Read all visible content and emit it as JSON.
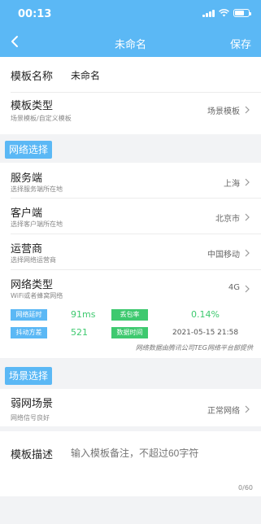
{
  "status_bar": {
    "time": "00:13"
  },
  "nav": {
    "back_icon": "chevron-left-icon",
    "title": "未命名",
    "save_label": "保存"
  },
  "template_name": {
    "label": "模板名称",
    "value": "未命名"
  },
  "template_type": {
    "title": "模板类型",
    "subtitle": "场景模板/自定义模板",
    "value": "场景模板"
  },
  "network_section": {
    "label": "网络选择"
  },
  "network_rows": [
    {
      "title": "服务端",
      "subtitle": "选择服务端所在地",
      "value": "上海"
    },
    {
      "title": "客户端",
      "subtitle": "选择客户端所在地",
      "value": "北京市"
    },
    {
      "title": "运营商",
      "subtitle": "选择网络运营商",
      "value": "中国移动"
    },
    {
      "title": "网络类型",
      "subtitle": "WiFi或者蜂窝网络",
      "value": "4G"
    }
  ],
  "metrics": {
    "latency_label": "网络延时",
    "latency_value": "91ms",
    "loss_label": "丢包率",
    "loss_value": "0.14%",
    "jitter_label": "抖动方差",
    "jitter_value": "521",
    "time_label": "数据时间",
    "time_value": "2021-05-15 21:58",
    "note": "网络数据由腾讯公司TEG网络平台部提供"
  },
  "scene_section": {
    "label": "场景选择"
  },
  "weak_network": {
    "title": "弱网场景",
    "subtitle": "网络信号良好",
    "value": "正常网络"
  },
  "description": {
    "label": "模板描述",
    "placeholder": "输入模板备注，不超过60字符",
    "counter": "0/60"
  },
  "colors": {
    "accent": "#5bb8f5",
    "green": "#3ec96f",
    "background": "#f2f3f5"
  }
}
